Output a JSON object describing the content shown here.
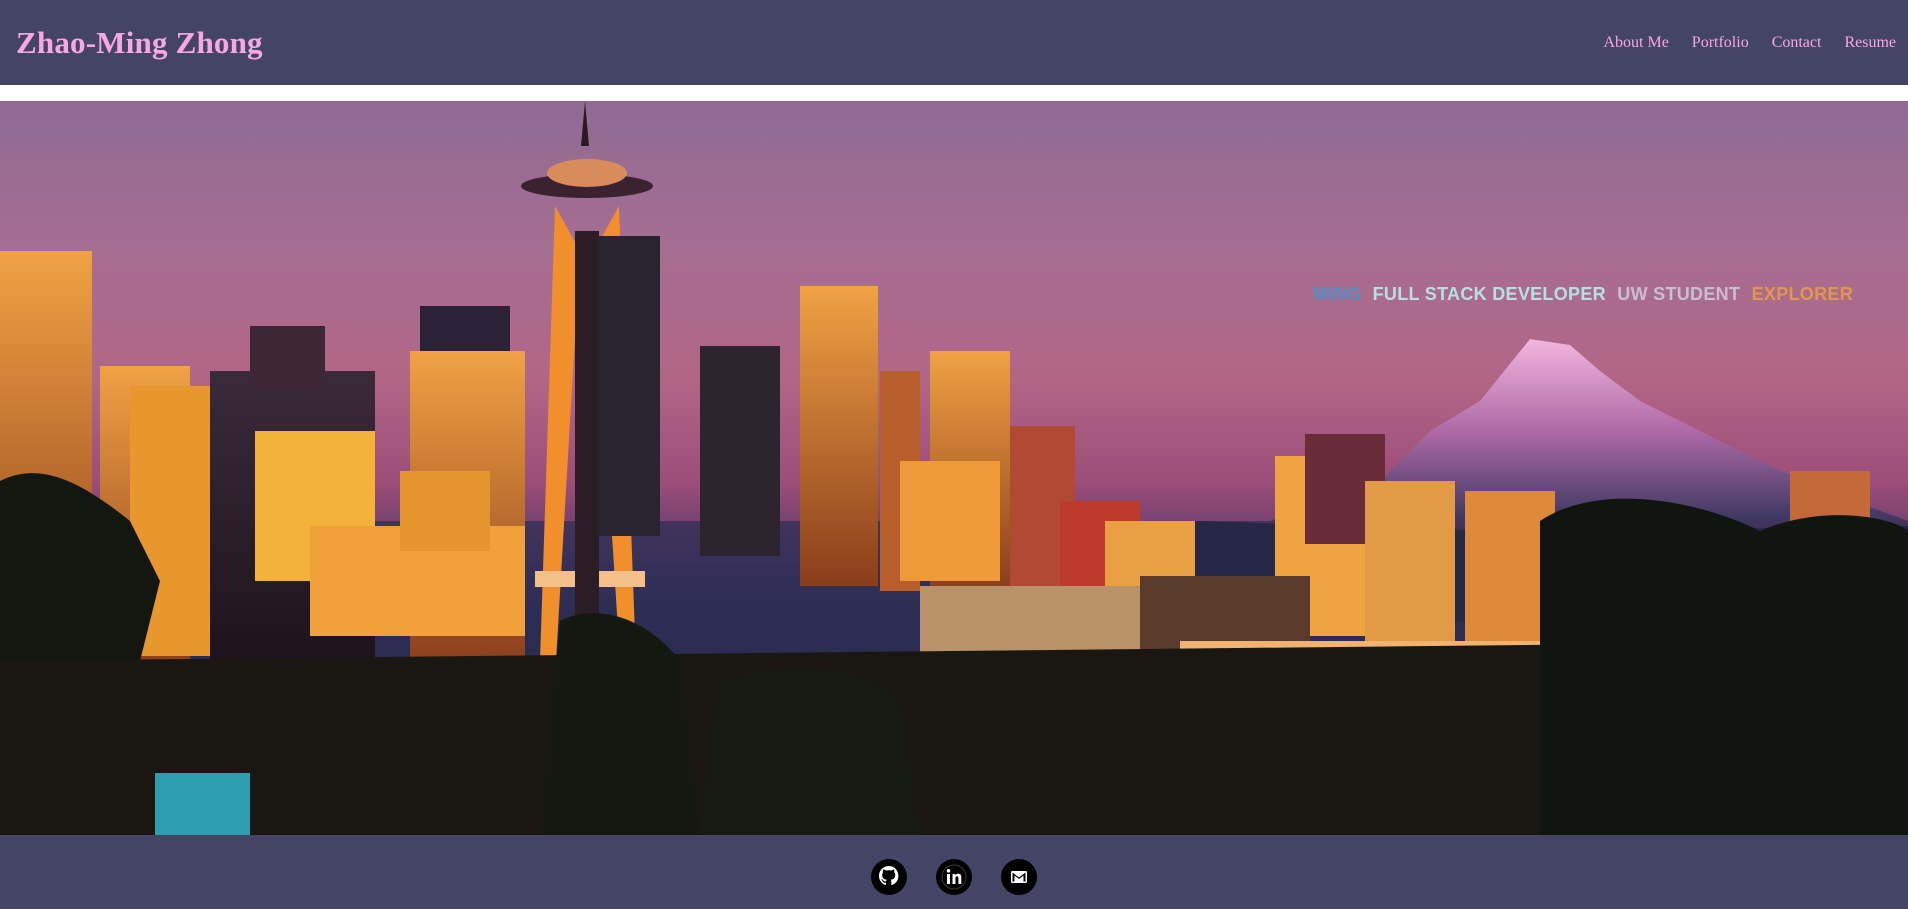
{
  "header": {
    "brand": "Zhao-Ming Zhong",
    "nav": [
      {
        "label": "About Me"
      },
      {
        "label": "Portfolio"
      },
      {
        "label": "Contact"
      },
      {
        "label": "Resume"
      }
    ]
  },
  "hero": {
    "tagline": [
      {
        "text": "MING",
        "color": "#4f90c9"
      },
      {
        "text": "FULL STACK DEVELOPER",
        "color": "#b7e0e4"
      },
      {
        "text": "UW STUDENT",
        "color": "#c7c0d2"
      },
      {
        "text": "EXPLORER",
        "color": "#e2974d"
      }
    ],
    "image": "seattle-skyline-sunset"
  },
  "footer": {
    "social": [
      {
        "icon": "github-icon"
      },
      {
        "icon": "linkedin-icon"
      },
      {
        "icon": "email-icon"
      }
    ]
  },
  "colors": {
    "nav_bg": "#434466",
    "brand": "#f7a8e2"
  }
}
